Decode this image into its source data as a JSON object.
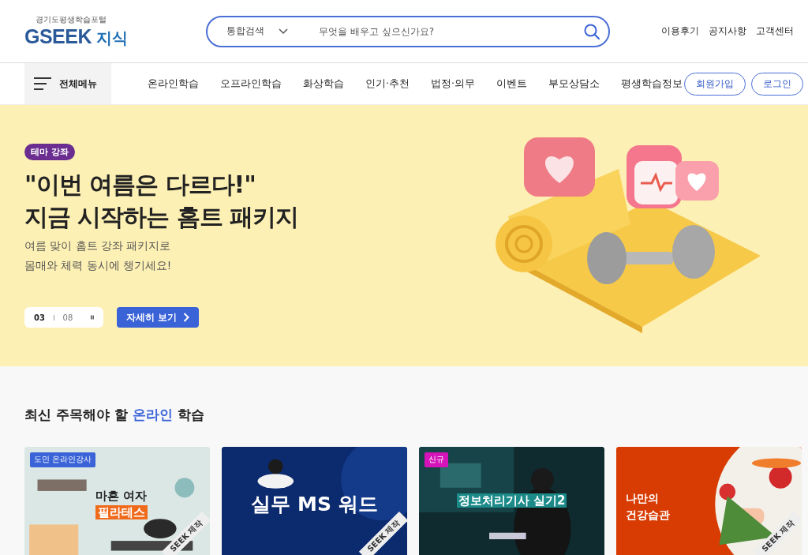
{
  "logo": {
    "tagline": "경기도평생학습포털",
    "brand": "GSEEK",
    "suffix": "지식"
  },
  "search": {
    "scope": "통합검색",
    "placeholder": "무엇을 배우고 싶으신가요?"
  },
  "top_links": [
    "이용후기",
    "공지사항",
    "고객센터"
  ],
  "nav": {
    "menu_label": "전체메뉴",
    "items": [
      "온라인학습",
      "오프라인학습",
      "화상학습",
      "인기·추천",
      "법정·의무",
      "이벤트",
      "부모상담소",
      "평생학습정보"
    ],
    "buttons": [
      "회원가입",
      "로그인"
    ]
  },
  "hero": {
    "badge": "테마 강좌",
    "title_lines": [
      "\"이번 여름은 다르다!\"",
      "지금 시작하는 홈트 패키지"
    ],
    "subtitle_lines": [
      "여름 맞이 홈트 강좌 패키지로",
      "몸매와 체력 동시에 챙기세요!"
    ],
    "pager": {
      "current": "03",
      "total": "08",
      "paused": false
    },
    "cta": "자세히 보기"
  },
  "section": {
    "title": "최신 주목해야 할 **온라인** 학습"
  },
  "cards": [
    {
      "kind": "mint",
      "badge": "도민 온라인강사",
      "color": "#3a63d8",
      "title_lines": [
        "마흔 여자",
        "필라테스"
      ],
      "ribbon": "SEEK 제작"
    },
    {
      "kind": "navy",
      "title_lines": [
        "실무 MS 워드"
      ],
      "ribbon": "SEEK 제작"
    },
    {
      "kind": "teal",
      "badge": "신규",
      "color": "#d414b8",
      "title_lines": [
        "정보처리기사 실기2"
      ]
    },
    {
      "kind": "orange",
      "title_lines": [
        "나만의",
        "건강습관"
      ],
      "ribbon": "SEEK 제작"
    }
  ]
}
